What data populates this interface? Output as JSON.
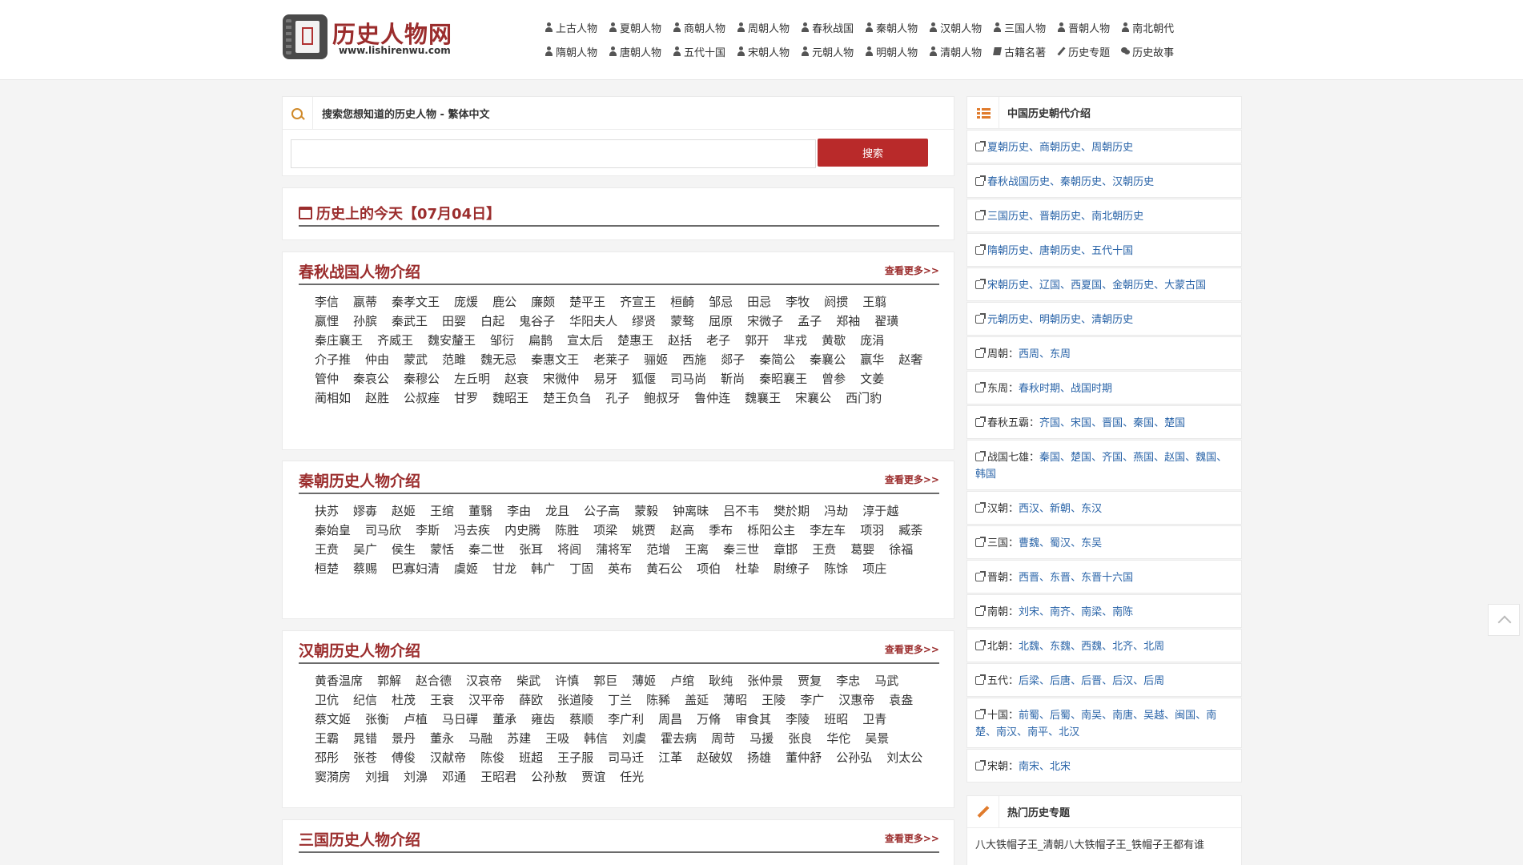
{
  "site": {
    "title": "历史人物网",
    "url": "www.lishirenwu.com",
    "logo_seal": "历史"
  },
  "nav": {
    "row1": [
      "上古人物",
      "夏朝人物",
      "商朝人物",
      "周朝人物",
      "春秋战国",
      "秦朝人物",
      "汉朝人物",
      "三国人物",
      "晋朝人物",
      "南北朝代"
    ],
    "row2": [
      "隋朝人物",
      "唐朝人物",
      "五代十国",
      "宋朝人物",
      "元朝人物",
      "明朝人物",
      "清朝人物",
      "古籍名著",
      "历史专题",
      "历史故事"
    ],
    "row2_icons": [
      "user-icon",
      "user-icon",
      "user-icon",
      "user-icon",
      "user-icon",
      "user-icon",
      "user-icon",
      "book-icon",
      "pencil-icon",
      "chat-icon"
    ]
  },
  "search": {
    "title": "搜索您想知道的历史人物 - 繁体中文",
    "placeholder": "",
    "button": "搜索"
  },
  "today": {
    "title": "历史上的今天【07月04日】"
  },
  "more_label": "查看更多>>",
  "sections": [
    {
      "title": "春秋战国人物介绍",
      "names": [
        "李信",
        "嬴蒂",
        "秦孝文王",
        "庞煖",
        "鹿公",
        "廉颇",
        "楚平王",
        "齐宣王",
        "桓齮",
        "邹忌",
        "田忌",
        "李牧",
        "阏掼",
        "王翦",
        "嬴悝",
        "孙膑",
        "秦武王",
        "田婴",
        "白起",
        "鬼谷子",
        "华阳夫人",
        "缪贤",
        "蒙骜",
        "屈原",
        "宋微子",
        "孟子",
        "郑袖",
        "翟璜",
        "秦庄襄王",
        "齐威王",
        "魏安釐王",
        "邹衍",
        "扁鹊",
        "宣太后",
        "楚惠王",
        "赵括",
        "老子",
        "郭开",
        "芈戎",
        "黄歇",
        "庞涓",
        "介子推",
        "仲由",
        "蒙武",
        "范雎",
        "魏无忌",
        "秦惠文王",
        "老莱子",
        "骊姬",
        "西施",
        "郯子",
        "秦简公",
        "秦襄公",
        "嬴华",
        "赵奢",
        "管仲",
        "秦哀公",
        "秦穆公",
        "左丘明",
        "赵衰",
        "宋微仲",
        "易牙",
        "狐偃",
        "司马尚",
        "靳尚",
        "秦昭襄王",
        "曾参",
        "文姜",
        "蔺相如",
        "赵胜",
        "公叔痤",
        "甘罗",
        "魏昭王",
        "楚王负刍",
        "孔子",
        "鲍叔牙",
        "鲁仲连",
        "魏襄王",
        "宋襄公",
        "西门豹"
      ]
    },
    {
      "title": "秦朝历史人物介绍",
      "names": [
        "扶苏",
        "嫪毐",
        "赵姬",
        "王绾",
        "董翳",
        "李由",
        "龙且",
        "公子高",
        "蒙毅",
        "钟离昧",
        "吕不韦",
        "樊於期",
        "冯劫",
        "淳于越",
        "秦始皇",
        "司马欣",
        "李斯",
        "冯去疾",
        "内史腾",
        "陈胜",
        "项梁",
        "姚贾",
        "赵高",
        "季布",
        "栎阳公主",
        "李左车",
        "项羽",
        "臧荼",
        "王贲",
        "吴广",
        "侯生",
        "蒙恬",
        "秦二世",
        "张耳",
        "将闾",
        "蒲将军",
        "范增",
        "王离",
        "秦三世",
        "章邯",
        "王贲",
        "葛婴",
        "徐福",
        "桓楚",
        "蔡赐",
        "巴寡妇清",
        "虞姬",
        "甘龙",
        "韩广",
        "丁固",
        "英布",
        "黄石公",
        "项伯",
        "杜挚",
        "尉缭子",
        "陈馀",
        "项庄"
      ]
    },
    {
      "title": "汉朝历史人物介绍",
      "names": [
        "黄香温席",
        "郭解",
        "赵合德",
        "汉哀帝",
        "柴武",
        "许慎",
        "郭巨",
        "薄姬",
        "卢绾",
        "耿纯",
        "张仲景",
        "贾复",
        "李忠",
        "马武",
        "卫伉",
        "纪信",
        "杜茂",
        "王衰",
        "汉平帝",
        "薛欧",
        "张道陵",
        "丁兰",
        "陈豨",
        "盖延",
        "薄昭",
        "王陵",
        "李广",
        "汉惠帝",
        "袁盎",
        "蔡文姬",
        "张衡",
        "卢植",
        "马日磾",
        "董承",
        "雍齿",
        "蔡顺",
        "李广利",
        "周昌",
        "万脩",
        "审食其",
        "李陵",
        "班昭",
        "卫青",
        "王霸",
        "晁错",
        "景丹",
        "董永",
        "马融",
        "苏建",
        "王吸",
        "韩信",
        "刘虞",
        "霍去病",
        "周苛",
        "马援",
        "张良",
        "华佗",
        "吴景",
        "邳彤",
        "张苍",
        "傅俊",
        "汉献帝",
        "陈俊",
        "班超",
        "王子服",
        "司马迁",
        "江革",
        "赵破奴",
        "扬雄",
        "董仲舒",
        "公孙弘",
        "刘太公",
        "窦漪房",
        "刘揖",
        "刘濞",
        "邓通",
        "王昭君",
        "公孙敖",
        "贾谊",
        "任光"
      ]
    },
    {
      "title": "三国历史人物介绍",
      "names": []
    }
  ],
  "sidebar": {
    "dynasty_title": "中国历史朝代介绍",
    "dynasty_items": [
      {
        "label": "",
        "links": [
          "夏朝历史",
          "商朝历史",
          "周朝历史"
        ]
      },
      {
        "label": "",
        "links": [
          "春秋战国历史",
          "秦朝历史",
          "汉朝历史"
        ]
      },
      {
        "label": "",
        "links": [
          "三国历史",
          "晋朝历史",
          "南北朝历史"
        ]
      },
      {
        "label": "",
        "links": [
          "隋朝历史",
          "唐朝历史",
          "五代十国"
        ]
      },
      {
        "label": "",
        "links": [
          "宋朝历史",
          "辽国",
          "西夏国",
          "金朝历史",
          "大蒙古国"
        ]
      },
      {
        "label": "",
        "links": [
          "元朝历史",
          "明朝历史",
          "清朝历史"
        ]
      },
      {
        "label": "周朝：",
        "links": [
          "西周",
          "东周"
        ]
      },
      {
        "label": "东周：",
        "links": [
          "春秋时期",
          "战国时期"
        ]
      },
      {
        "label": "春秋五霸：",
        "links": [
          "齐国",
          "宋国",
          "晋国",
          "秦国",
          "楚国"
        ]
      },
      {
        "label": "战国七雄：",
        "links": [
          "秦国",
          "楚国",
          "齐国",
          "燕国",
          "赵国",
          "魏国",
          "韩国"
        ]
      },
      {
        "label": "汉朝：",
        "links": [
          "西汉",
          "新朝",
          "东汉"
        ]
      },
      {
        "label": "三国：",
        "links": [
          "曹魏",
          "蜀汉",
          "东吴"
        ]
      },
      {
        "label": "晋朝：",
        "links": [
          "西晋",
          "东晋",
          "东晋十六国"
        ]
      },
      {
        "label": "南朝：",
        "links": [
          "刘宋",
          "南齐",
          "南梁",
          "南陈"
        ]
      },
      {
        "label": "北朝：",
        "links": [
          "北魏",
          "东魏",
          "西魏",
          "北齐",
          "北周"
        ]
      },
      {
        "label": "五代：",
        "links": [
          "后梁",
          "后唐",
          "后晋",
          "后汉",
          "后周"
        ]
      },
      {
        "label": "十国：",
        "links": [
          "前蜀",
          "后蜀",
          "南吴",
          "南唐",
          "吴越",
          "闽国",
          "南楚",
          "南汉",
          "南平",
          "北汉"
        ]
      },
      {
        "label": "宋朝：",
        "links": [
          "南宋",
          "北宋"
        ]
      }
    ],
    "hot_title": "热门历史专题",
    "hot_first": "八大铁帽子王_清朝八大铁帽子王_铁帽子王都有谁"
  }
}
